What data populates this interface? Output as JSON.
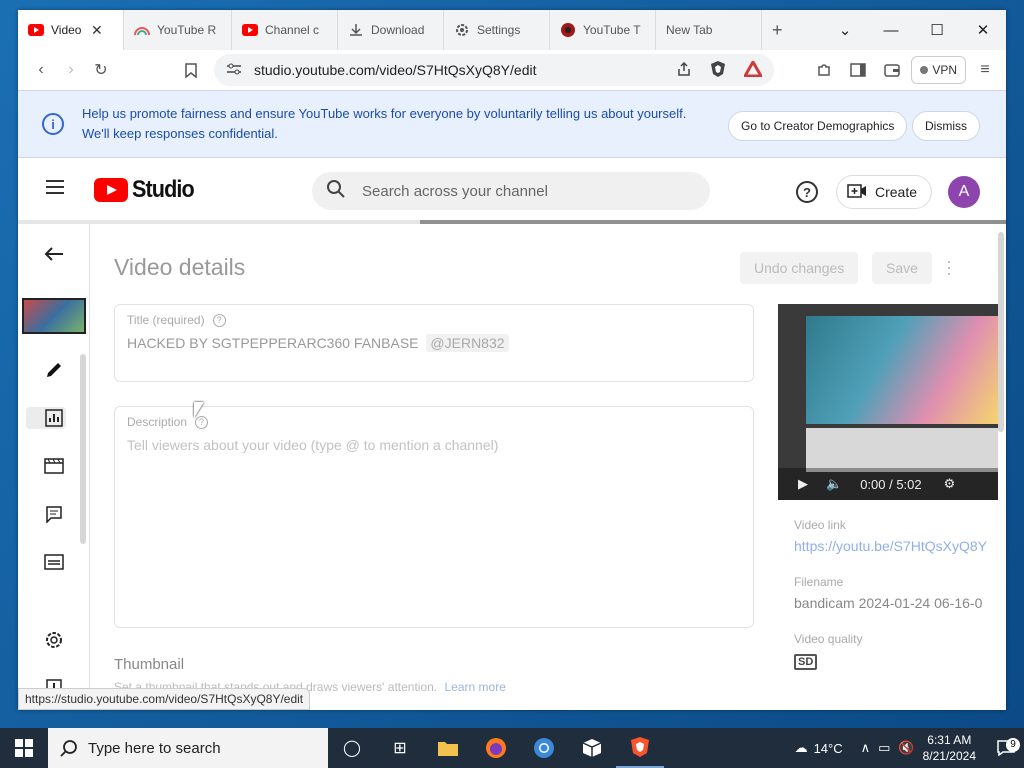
{
  "browser": {
    "tabs": [
      {
        "label": "Video",
        "icon": "youtube-icon",
        "active": true
      },
      {
        "label": "YouTube R",
        "icon": "rainbow-icon"
      },
      {
        "label": "Channel c",
        "icon": "youtube-icon"
      },
      {
        "label": "Download",
        "icon": "download-icon"
      },
      {
        "label": "Settings",
        "icon": "gear-icon"
      },
      {
        "label": "YouTube T",
        "icon": "record-icon"
      },
      {
        "label": "New Tab",
        "icon": ""
      }
    ],
    "new_tab": "+",
    "url": "studio.youtube.com/video/S7HtQsXyQ8Y/edit",
    "vpn_label": "VPN"
  },
  "infobar": {
    "message": "Help us promote fairness and ensure YouTube works for everyone by voluntarily telling us about yourself. We'll keep responses confidential.",
    "primary_action": "Go to Creator Demographics",
    "dismiss": "Dismiss"
  },
  "studio": {
    "logo_text": "Studio",
    "search_placeholder": "Search across your channel",
    "create_label": "Create",
    "avatar_letter": "A",
    "load_progress": 0.6
  },
  "editor": {
    "page_title": "Video details",
    "undo_label": "Undo changes",
    "save_label": "Save",
    "title_label": "Title (required)",
    "title_value": "HACKED BY SGTPEPPERARC360 FANBASE",
    "title_mention": "@JERN832",
    "description_label": "Description",
    "description_placeholder": "Tell viewers about your video (type @ to mention a channel)",
    "thumbnail_heading": "Thumbnail",
    "thumbnail_sub": "Set a thumbnail that stands out and draws viewers' attention.",
    "learn_more": "Learn more"
  },
  "preview": {
    "time": "0:00 / 5:02",
    "video_link_label": "Video link",
    "video_link": "https://youtu.be/S7HtQsXyQ8Y",
    "filename_label": "Filename",
    "filename": "bandicam 2024-01-24 06-16-0",
    "quality_label": "Video quality",
    "quality_badge": "SD"
  },
  "status_url": "https://studio.youtube.com/video/S7HtQsXyQ8Y/edit",
  "taskbar": {
    "search_placeholder": "Type here to search",
    "weather": "14°C",
    "time": "6:31 AM",
    "date": "8/21/2024",
    "notification_count": "9"
  }
}
